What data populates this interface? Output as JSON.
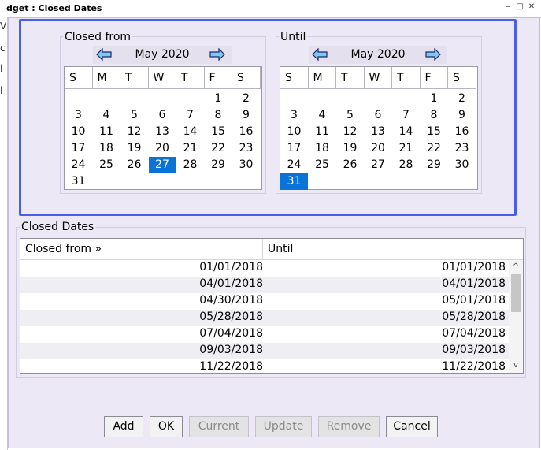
{
  "window": {
    "title": "dget : Closed Dates"
  },
  "left_strip": [
    "V",
    "c",
    "l",
    "l"
  ],
  "weekday_headers": [
    "S",
    "M",
    "T",
    "W",
    "T",
    "F",
    "S"
  ],
  "calendars": [
    {
      "legend": "Closed from",
      "month_label": "May 2020",
      "selected_day": 27,
      "weeks": [
        [
          "",
          "",
          "",
          "",
          "",
          "1",
          "2"
        ],
        [
          "3",
          "4",
          "5",
          "6",
          "7",
          "8",
          "9"
        ],
        [
          "10",
          "11",
          "12",
          "13",
          "14",
          "15",
          "16"
        ],
        [
          "17",
          "18",
          "19",
          "20",
          "21",
          "22",
          "23"
        ],
        [
          "24",
          "25",
          "26",
          "27",
          "28",
          "29",
          "30"
        ],
        [
          "31",
          "",
          "",
          "",
          "",
          "",
          ""
        ]
      ]
    },
    {
      "legend": "Until",
      "month_label": "May 2020",
      "selected_day": 31,
      "weeks": [
        [
          "",
          "",
          "",
          "",
          "",
          "1",
          "2"
        ],
        [
          "3",
          "4",
          "5",
          "6",
          "7",
          "8",
          "9"
        ],
        [
          "10",
          "11",
          "12",
          "13",
          "14",
          "15",
          "16"
        ],
        [
          "17",
          "18",
          "19",
          "20",
          "21",
          "22",
          "23"
        ],
        [
          "24",
          "25",
          "26",
          "27",
          "28",
          "29",
          "30"
        ],
        [
          "31",
          "",
          "",
          "",
          "",
          "",
          ""
        ]
      ]
    }
  ],
  "closed_dates": {
    "legend": "Closed Dates",
    "columns": [
      "Closed from »",
      "Until"
    ],
    "rows": [
      [
        "01/01/2018",
        "01/01/2018"
      ],
      [
        "04/01/2018",
        "04/01/2018"
      ],
      [
        "04/30/2018",
        "05/01/2018"
      ],
      [
        "05/28/2018",
        "05/28/2018"
      ],
      [
        "07/04/2018",
        "07/04/2018"
      ],
      [
        "09/03/2018",
        "09/03/2018"
      ],
      [
        "11/22/2018",
        "11/22/2018"
      ]
    ]
  },
  "buttons": {
    "add": "Add",
    "ok": "OK",
    "current": "Current",
    "update": "Update",
    "remove": "Remove",
    "cancel": "Cancel"
  },
  "colors": {
    "selection": "#0a73d8",
    "highlight_border": "#4a5fe8",
    "panel": "#ece8f6"
  }
}
